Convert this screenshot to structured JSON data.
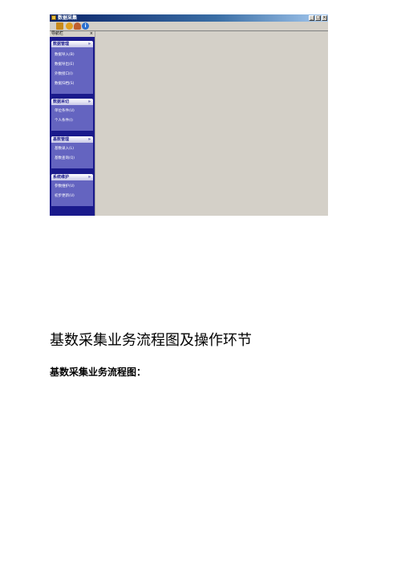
{
  "window": {
    "title": "数据采集",
    "min": "_",
    "max": "□",
    "close": "×"
  },
  "toolbar": {
    "info_glyph": "i"
  },
  "sidebar": {
    "title": "导航栏",
    "close": "×",
    "groups": [
      {
        "title": "数据管理",
        "chevron": "»",
        "items": [
          "数据导入(B)",
          "数据导出(E)",
          "外数接口(I)",
          "数据归档(S)"
        ]
      },
      {
        "title": "数据采切",
        "chevron": "»",
        "items": [
          "单位条件(U)",
          "个人条件(I)"
        ]
      },
      {
        "title": "基数管理",
        "chevron": "»",
        "items": [
          "基数录入(L)",
          "基数查询(Q)"
        ]
      },
      {
        "title": "系统维护",
        "chevron": "»",
        "items": [
          "参数维护(U)",
          "初步更新(U)"
        ]
      }
    ]
  },
  "doc": {
    "heading": "基数采集业务流程图及操作环节",
    "subheading": "基数采集业务流程图："
  }
}
